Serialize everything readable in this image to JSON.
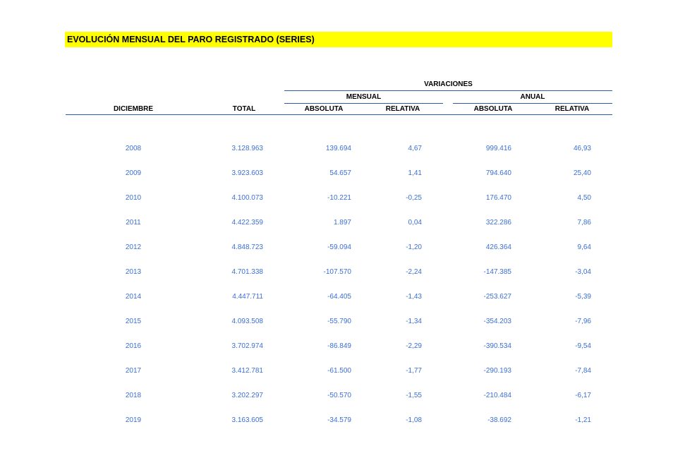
{
  "title": "EVOLUCIÓN MENSUAL DEL PARO REGISTRADO (SERIES)",
  "headers": {
    "variaciones": "VARIACIONES",
    "mensual": "MENSUAL",
    "anual": "ANUAL",
    "diciembre": "DICIEMBRE",
    "total": "TOTAL",
    "absoluta_m": "ABSOLUTA",
    "relativa_m": "RELATIVA",
    "absoluta_a": "ABSOLUTA",
    "relativa_a": "RELATIVA"
  },
  "rows": [
    {
      "year": "2008",
      "total": "3.128.963",
      "abs_m": "139.694",
      "rel_m": "4,67",
      "abs_a": "999.416",
      "rel_a": "46,93"
    },
    {
      "year": "2009",
      "total": "3.923.603",
      "abs_m": "54.657",
      "rel_m": "1,41",
      "abs_a": "794.640",
      "rel_a": "25,40"
    },
    {
      "year": "2010",
      "total": "4.100.073",
      "abs_m": "-10.221",
      "rel_m": "-0,25",
      "abs_a": "176.470",
      "rel_a": "4,50"
    },
    {
      "year": "2011",
      "total": "4.422.359",
      "abs_m": "1.897",
      "rel_m": "0,04",
      "abs_a": "322.286",
      "rel_a": "7,86"
    },
    {
      "year": "2012",
      "total": "4.848.723",
      "abs_m": "-59.094",
      "rel_m": "-1,20",
      "abs_a": "426.364",
      "rel_a": "9,64"
    },
    {
      "year": "2013",
      "total": "4.701.338",
      "abs_m": "-107.570",
      "rel_m": "-2,24",
      "abs_a": "-147.385",
      "rel_a": "-3,04"
    },
    {
      "year": "2014",
      "total": "4.447.711",
      "abs_m": "-64.405",
      "rel_m": "-1,43",
      "abs_a": "-253.627",
      "rel_a": "-5,39"
    },
    {
      "year": "2015",
      "total": "4.093.508",
      "abs_m": "-55.790",
      "rel_m": "-1,34",
      "abs_a": "-354.203",
      "rel_a": "-7,96"
    },
    {
      "year": "2016",
      "total": "3.702.974",
      "abs_m": "-86.849",
      "rel_m": "-2,29",
      "abs_a": "-390.534",
      "rel_a": "-9,54"
    },
    {
      "year": "2017",
      "total": "3.412.781",
      "abs_m": "-61.500",
      "rel_m": "-1,77",
      "abs_a": "-290.193",
      "rel_a": "-7,84"
    },
    {
      "year": "2018",
      "total": "3.202.297",
      "abs_m": "-50.570",
      "rel_m": "-1,55",
      "abs_a": "-210.484",
      "rel_a": "-6,17"
    },
    {
      "year": "2019",
      "total": "3.163.605",
      "abs_m": "-34.579",
      "rel_m": "-1,08",
      "abs_a": "-38.692",
      "rel_a": "-1,21"
    }
  ]
}
